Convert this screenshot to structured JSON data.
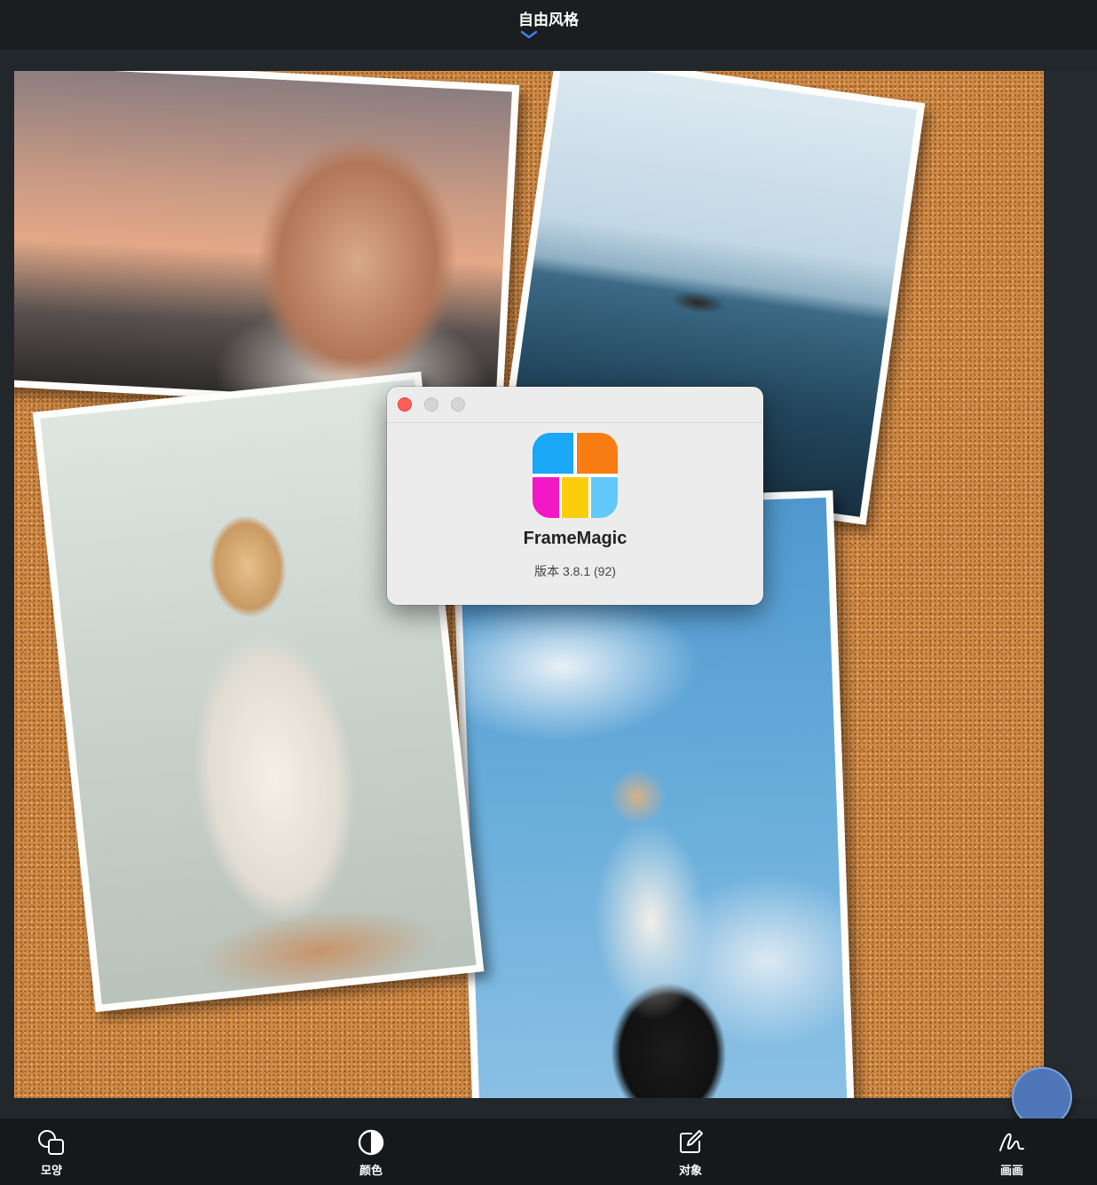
{
  "header": {
    "title": "自由风格"
  },
  "dialog": {
    "app_name": "FrameMagic",
    "version": "版本 3.8.1 (92)",
    "icon": "framemagic-app-icon",
    "icon_colors": [
      "#1aa7f5",
      "#f77d12",
      "#f417c6",
      "#fbcd0d",
      "#61c8f9"
    ]
  },
  "toolbar": {
    "items": [
      {
        "label": "모양",
        "icon": "shapes-icon"
      },
      {
        "label": "颜色",
        "icon": "contrast-icon"
      },
      {
        "label": "对象",
        "icon": "edit-square-icon"
      },
      {
        "label": "画画",
        "icon": "draw-icon"
      }
    ]
  },
  "colors": {
    "accent": "#3b82f6",
    "fab": "#4f76b8",
    "cork": "#d08a45",
    "close": "#fe5f57"
  }
}
